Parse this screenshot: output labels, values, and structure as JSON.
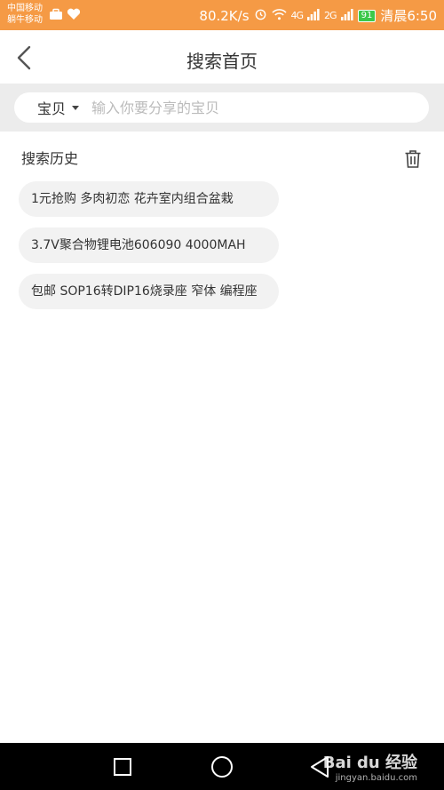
{
  "status_bar": {
    "carrier_1": "中国移动",
    "carrier_2": "躺牛移动",
    "speed": "80.2K/s",
    "signal_1": "4G",
    "signal_2": "2G",
    "battery": "91",
    "time": "清晨6:50"
  },
  "header": {
    "title": "搜索首页"
  },
  "search": {
    "category": "宝贝",
    "placeholder": "输入你要分享的宝贝"
  },
  "history": {
    "title": "搜索历史",
    "items": [
      "1元抢购 多肉初恋 花卉室内组合盆栽",
      "3.7V聚合物锂电池606090 4000MAH",
      "包邮 SOP16转DIP16烧录座 窄体 编程座"
    ]
  },
  "watermark": {
    "brand": "Bai du 经验",
    "url": "jingyan.baidu.com"
  }
}
